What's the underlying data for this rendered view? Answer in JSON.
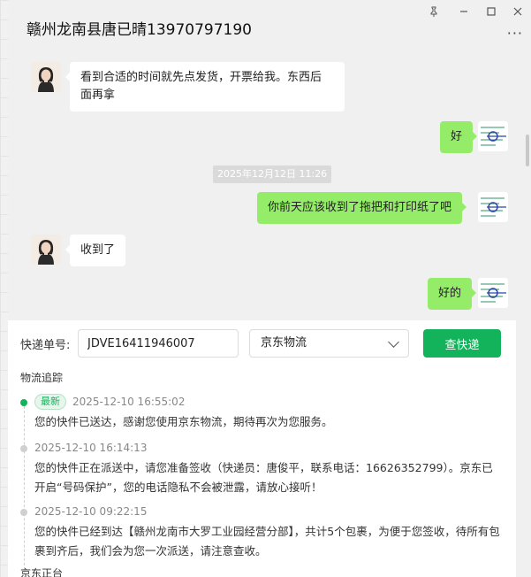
{
  "window": {
    "title": "赣州龙南县唐已晴13970797190",
    "controls": [
      "pin-icon",
      "minimize-icon",
      "maximize-icon",
      "close-icon"
    ],
    "more": "···"
  },
  "messages": [
    {
      "side": "left",
      "text1": "看到合适的时间就先点发货，开票给我。东西后",
      "text2": "面再拿"
    },
    {
      "side": "right",
      "text": "好"
    },
    {
      "timestamp": "2025年12月12日 11:26"
    },
    {
      "side": "right",
      "text": "你前天应该收到了拖把和打印纸了吧"
    },
    {
      "side": "left",
      "text": "收到了"
    },
    {
      "side": "right",
      "text": "好的"
    }
  ],
  "tracking": {
    "label": "快递单号:",
    "number": "JDVE16411946007",
    "carrier": "京东物流",
    "query_button": "查快递",
    "section_title": "物流追踪",
    "events": [
      {
        "badge": "最新",
        "time": "2025-12-10 16:55:02",
        "text": "您的快件已送达，感谢您使用京东物流，期待再次为您服务。"
      },
      {
        "time": "2025-12-10 16:14:13",
        "text": "您的快件正在派送中，请您准备签收（快递员：唐俊平，联系电话：16626352799）。京东已开启“号码保护”，您的电话隐私不会被泄露，请放心接听！"
      },
      {
        "time": "2025-12-10 09:22:15",
        "text": "您的快件已经到达【赣州龙南市大罗工业园经营分部】，共计5个包裹，为便于您签收，待所有包裹到齐后，我们会为您一次派送，请注意查收。"
      }
    ],
    "cut_text": "京东正台"
  },
  "colors": {
    "accent": "#12b35b",
    "bubble_self": "#95ec69",
    "bubble_other": "#ffffff"
  }
}
